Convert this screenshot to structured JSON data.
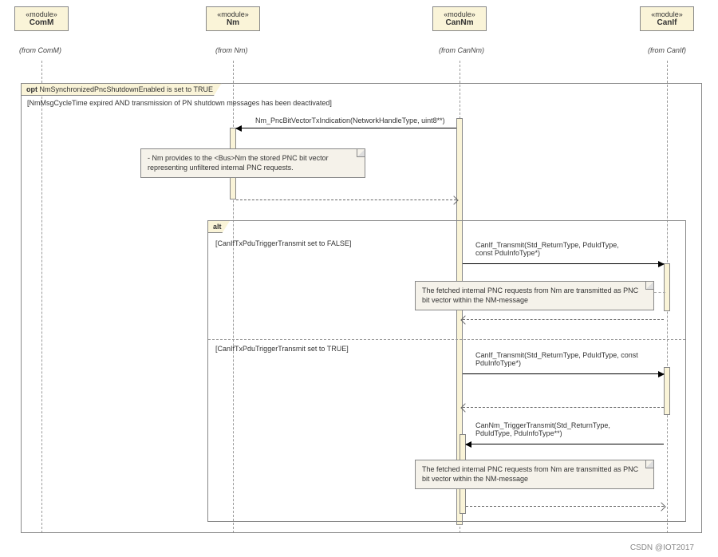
{
  "lifelines": [
    {
      "stereotype": "«module»",
      "name": "ComM",
      "from": "(from ComM)"
    },
    {
      "stereotype": "«module»",
      "name": "Nm",
      "from": "(from Nm)"
    },
    {
      "stereotype": "«module»",
      "name": "CanNm",
      "from": "(from CanNm)"
    },
    {
      "stereotype": "«module»",
      "name": "CanIf",
      "from": "(from CanIf)"
    }
  ],
  "outerFrame": {
    "operator": "opt",
    "guardLabel": "NmSynchronizedPncShutdownEnabled is set to TRUE",
    "condition": "[NmMsgCycleTime expired AND transmission of PN shutdown messages has been deactivated]"
  },
  "messages": {
    "pncBitVectorTx": "Nm_PncBitVectorTxIndication(NetworkHandleType, uint8**)",
    "canIfTransmit1": "CanIf_Transmit(Std_ReturnType, PduIdType,\nconst PduInfoType*)",
    "canIfTransmit2": "CanIf_Transmit(Std_ReturnType, PduIdType, const\nPduInfoType*)",
    "canNmTrigger": "CanNm_TriggerTransmit(Std_ReturnType,\nPduIdType, PduInfoType**)"
  },
  "notes": {
    "nmProvides": "- Nm provides to the <Bus>Nm the stored PNC bit vector representing unfiltered internal PNC requests.",
    "fetched": "The fetched internal PNC requests from Nm are transmitted as PNC bit vector within the NM-message"
  },
  "altFrame": {
    "operator": "alt",
    "guardFalse": "[CanIfTxPduTriggerTransmit set to FALSE]",
    "guardTrue": "[CanIfTxPduTriggerTransmit set to TRUE]"
  },
  "watermark": "CSDN @IOT2017"
}
